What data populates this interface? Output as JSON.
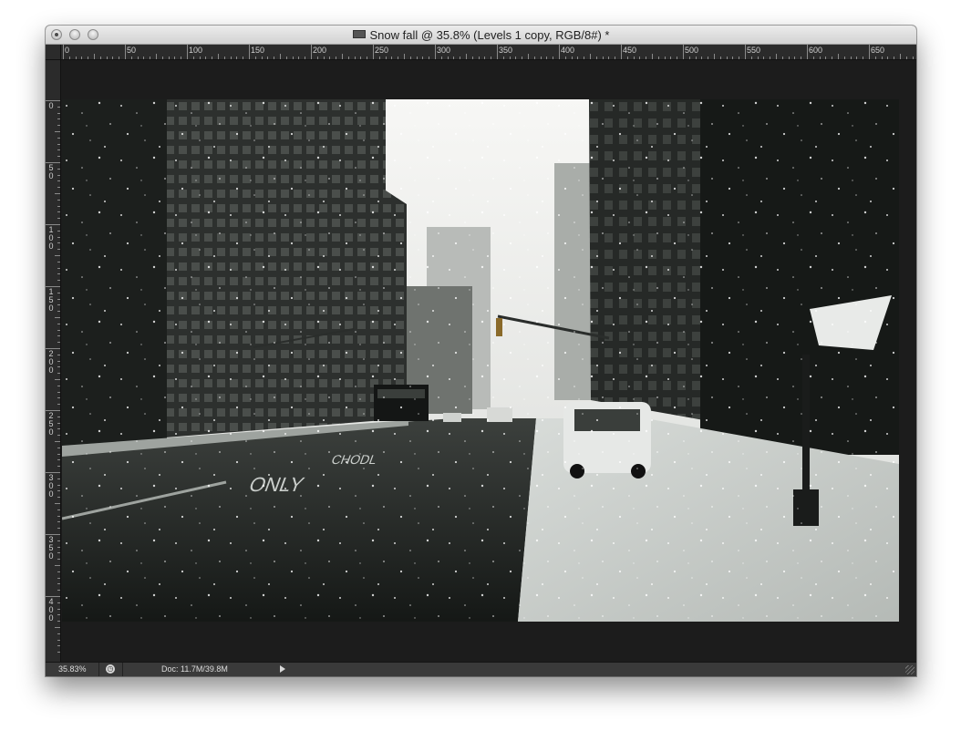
{
  "window": {
    "title": "Snow fall @ 35.8% (Levels 1 copy, RGB/8#) *",
    "doc_icon": "photoshop-document-icon"
  },
  "rulers": {
    "horizontal": [
      "0",
      "50",
      "100",
      "150",
      "200",
      "250",
      "300",
      "350",
      "400",
      "450",
      "500",
      "550",
      "600",
      "650"
    ],
    "vertical": [
      "0",
      "50",
      "100",
      "150",
      "200",
      "250",
      "300",
      "350",
      "400"
    ]
  },
  "canvas": {
    "image_description": "snowy city street photograph"
  },
  "statusbar": {
    "zoom": "35.83%",
    "doc_size": "Doc: 11.7M/39.8M",
    "status_icon": "clock-icon",
    "menu_arrow": "play-triangle-icon"
  },
  "colors": {
    "canvas_bg": "#1c1c1c",
    "ruler_bg": "#2b2b2b",
    "statusbar_bg": "#3a3a3a"
  }
}
